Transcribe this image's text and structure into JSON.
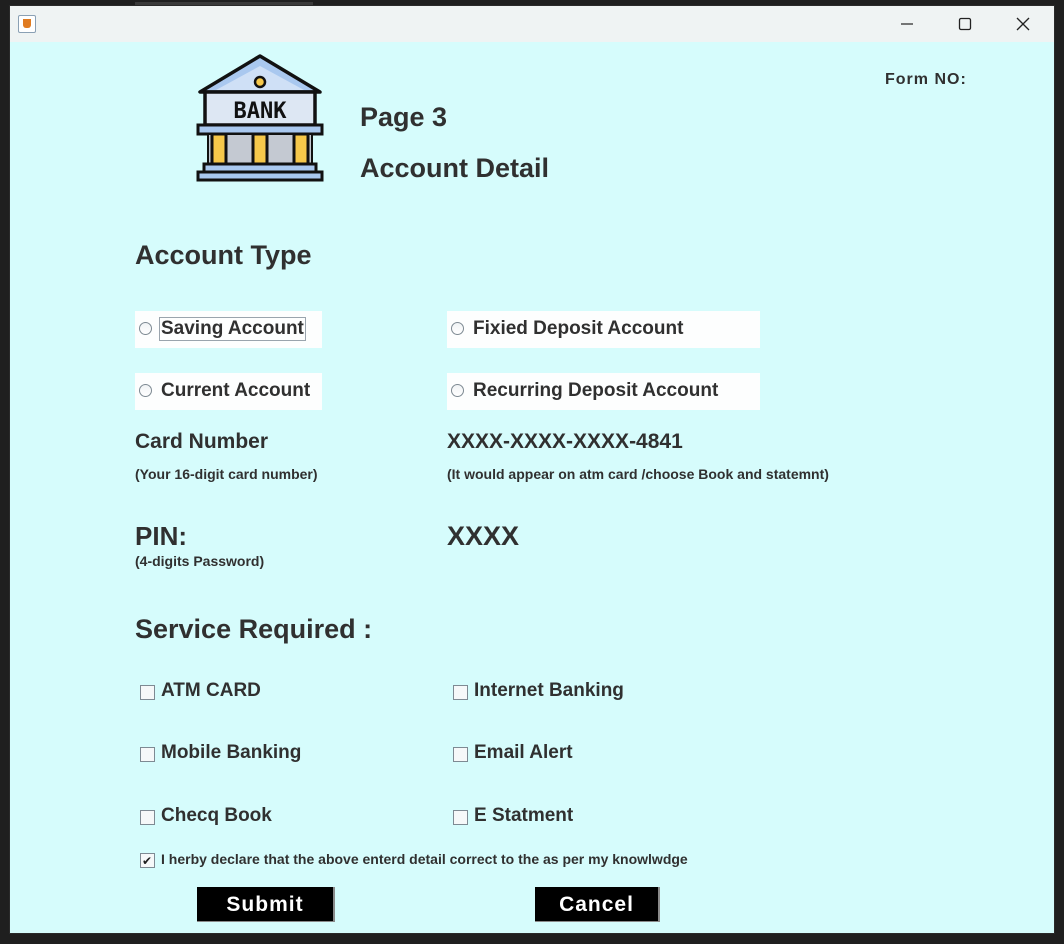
{
  "window": {
    "title": "",
    "controls": [
      "minimize-icon",
      "maximize-icon",
      "close-icon"
    ]
  },
  "header": {
    "logo_text": "BANK",
    "page": "Page 3",
    "subtitle": "Account Detail",
    "form_no_label": "Form NO:"
  },
  "account_type": {
    "title": "Account Type",
    "options": [
      {
        "label": "Saving Account",
        "selected": false
      },
      {
        "label": "Fixied  Deposit Account",
        "selected": false
      },
      {
        "label": "Current Account",
        "selected": false
      },
      {
        "label": "Recurring Deposit Account",
        "selected": false
      }
    ]
  },
  "card": {
    "label": "Card Number",
    "hint": "(Your 16-digit card number)",
    "value": "XXXX-XXXX-XXXX-4841",
    "value_hint": "(It would appear on atm card /choose Book and statemnt)"
  },
  "pin": {
    "label": "PIN:",
    "hint": "(4-digits Password)",
    "value": "XXXX"
  },
  "services": {
    "title": "Service Required :",
    "items": [
      {
        "label": "ATM CARD",
        "checked": false
      },
      {
        "label": "Internet Banking",
        "checked": false
      },
      {
        "label": "Mobile Banking",
        "checked": false
      },
      {
        "label": "Email Alert",
        "checked": false
      },
      {
        "label": "Checq Book",
        "checked": false
      },
      {
        "label": "E Statment",
        "checked": false
      }
    ]
  },
  "declaration": {
    "label": "I herby declare that  the above enterd detail correct to the as per my knowlwdge",
    "checked": true
  },
  "buttons": {
    "submit": "Submit",
    "cancel": "Cancel"
  },
  "colors": {
    "background": "#d6fcfc",
    "button_bg": "#000000",
    "button_text": "#ffffff",
    "text": "#303030"
  }
}
